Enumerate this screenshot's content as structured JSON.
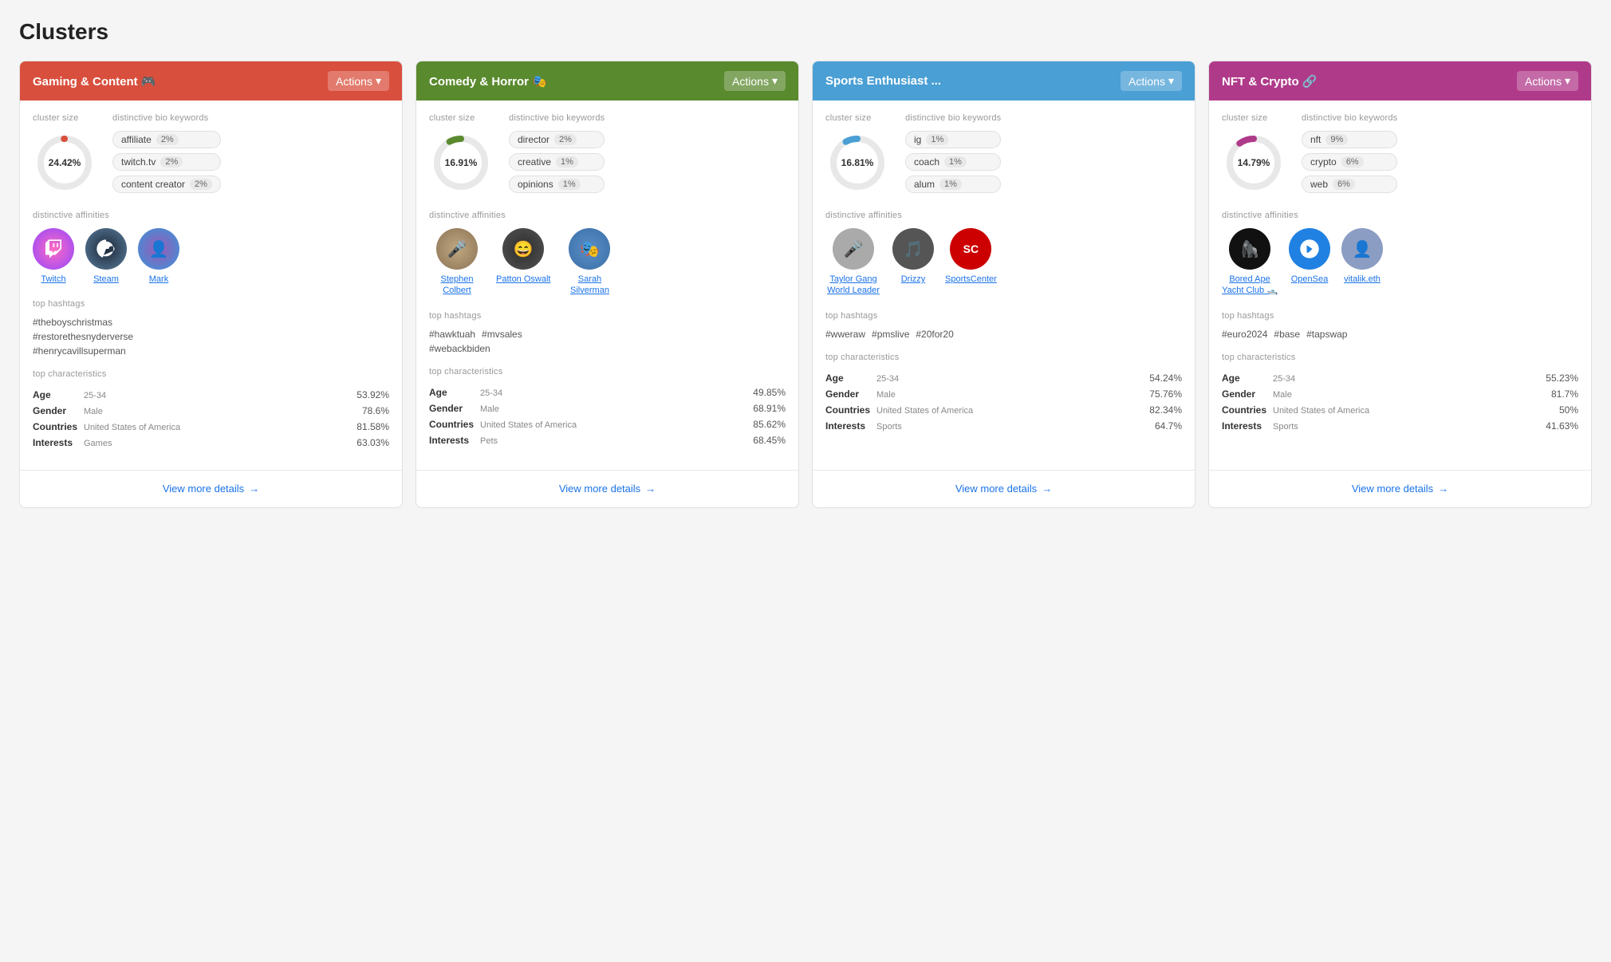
{
  "page": {
    "title": "Clusters"
  },
  "clusters": [
    {
      "id": "gaming",
      "name": "Gaming & Content 🎮",
      "color": "#d94f3d",
      "actions_label": "Actions",
      "size_pct": "24.42%",
      "donut_color": "#d94f3d",
      "donut_value": 24.42,
      "keywords": [
        {
          "label": "affiliate",
          "pct": "2%"
        },
        {
          "label": "twitch.tv",
          "pct": "2%"
        },
        {
          "label": "content creator",
          "pct": "2%"
        }
      ],
      "affinities": [
        {
          "name": "Twitch",
          "avatar_class": "avatar-twitch",
          "icon": "🎮"
        },
        {
          "name": "Steam",
          "avatar_class": "avatar-steam",
          "icon": "🎲"
        },
        {
          "name": "Mark",
          "avatar_class": "avatar-mark",
          "icon": "👤"
        }
      ],
      "hashtags": [
        "#theboyschristmas",
        "#restorethesnyderverse",
        "#henrycavillsuperman"
      ],
      "hashtags_inline": false,
      "characteristics": [
        {
          "label": "Age",
          "value": "25-34",
          "pct": "53.92%"
        },
        {
          "label": "Gender",
          "value": "Male",
          "pct": "78.6%"
        },
        {
          "label": "Countries",
          "value": "United States of America",
          "pct": "81.58%"
        },
        {
          "label": "Interests",
          "value": "Games",
          "pct": "63.03%"
        }
      ]
    },
    {
      "id": "comedy",
      "name": "Comedy & Horror 🎭",
      "color": "#5a8a2e",
      "actions_label": "Actions",
      "size_pct": "16.91%",
      "donut_color": "#5a8a2e",
      "donut_value": 16.91,
      "keywords": [
        {
          "label": "director",
          "pct": "2%"
        },
        {
          "label": "creative",
          "pct": "1%"
        },
        {
          "label": "opinions",
          "pct": "1%"
        }
      ],
      "affinities": [
        {
          "name": "Stephen Colbert",
          "avatar_class": "avatar-stephen",
          "icon": "🎤"
        },
        {
          "name": "Patton Oswalt",
          "avatar_class": "avatar-patton",
          "icon": "😄"
        },
        {
          "name": "Sarah Silverman",
          "avatar_class": "avatar-sarah",
          "icon": "🎭"
        }
      ],
      "hashtags": [
        "#hawktuah",
        "#mvsales",
        "#webackbiden"
      ],
      "hashtags_inline": true,
      "characteristics": [
        {
          "label": "Age",
          "value": "25-34",
          "pct": "49.85%"
        },
        {
          "label": "Gender",
          "value": "Male",
          "pct": "68.91%"
        },
        {
          "label": "Countries",
          "value": "United States of America",
          "pct": "85.62%"
        },
        {
          "label": "Interests",
          "value": "Pets",
          "pct": "68.45%"
        }
      ]
    },
    {
      "id": "sports",
      "name": "Sports Enthusiast ...",
      "color": "#4a9fd4",
      "actions_label": "Actions",
      "size_pct": "16.81%",
      "donut_color": "#4a9fd4",
      "donut_value": 16.81,
      "keywords": [
        {
          "label": "ig",
          "pct": "1%"
        },
        {
          "label": "coach",
          "pct": "1%"
        },
        {
          "label": "alum",
          "pct": "1%"
        }
      ],
      "affinities": [
        {
          "name": "Taylor Gang World Leader",
          "avatar_class": "avatar-taylor",
          "icon": "🎤"
        },
        {
          "name": "Drizzy",
          "avatar_class": "avatar-drizzy",
          "icon": "🎵"
        },
        {
          "name": "SportsCenter",
          "avatar_class": "avatar-sports",
          "icon": "🏆"
        }
      ],
      "hashtags": [
        "#wweraw",
        "#pmslive",
        "#20for20"
      ],
      "hashtags_inline": true,
      "characteristics": [
        {
          "label": "Age",
          "value": "25-34",
          "pct": "54.24%"
        },
        {
          "label": "Gender",
          "value": "Male",
          "pct": "75.76%"
        },
        {
          "label": "Countries",
          "value": "United States of America",
          "pct": "82.34%"
        },
        {
          "label": "Interests",
          "value": "Sports",
          "pct": "64.7%"
        }
      ]
    },
    {
      "id": "nft",
      "name": "NFT & Crypto 🔗",
      "color": "#b03a8a",
      "actions_label": "Actions",
      "size_pct": "14.79%",
      "donut_color": "#b03a8a",
      "donut_value": 14.79,
      "keywords": [
        {
          "label": "nft",
          "pct": "9%"
        },
        {
          "label": "crypto",
          "pct": "6%"
        },
        {
          "label": "web",
          "pct": "6%"
        }
      ],
      "affinities": [
        {
          "name": "Bored Ape Yacht Club 🛥️",
          "avatar_class": "avatar-bored",
          "icon": "🦍"
        },
        {
          "name": "OpenSea",
          "avatar_class": "avatar-opensea",
          "icon": "⛵"
        },
        {
          "name": "vitalik.eth",
          "avatar_class": "avatar-vitalik",
          "icon": "👤"
        }
      ],
      "hashtags": [
        "#euro2024",
        "#base",
        "#tapswap"
      ],
      "hashtags_inline": true,
      "characteristics": [
        {
          "label": "Age",
          "value": "25-34",
          "pct": "55.23%"
        },
        {
          "label": "Gender",
          "value": "Male",
          "pct": "81.7%"
        },
        {
          "label": "Countries",
          "value": "United States of America",
          "pct": "50%"
        },
        {
          "label": "Interests",
          "value": "Sports",
          "pct": "41.63%"
        }
      ]
    }
  ],
  "labels": {
    "cluster_size": "Cluster size",
    "distinctive_bio": "Distinctive bio keywords",
    "distinctive_affinities": "Distinctive affinities",
    "top_hashtags": "Top hashtags",
    "top_characteristics": "Top characteristics",
    "view_more": "View more details",
    "arrow": "→"
  }
}
